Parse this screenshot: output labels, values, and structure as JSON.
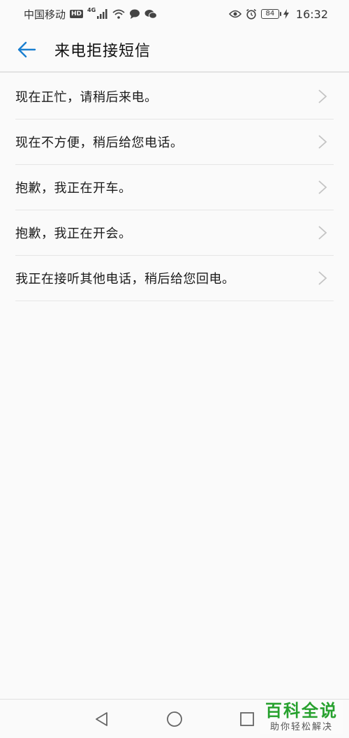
{
  "status_bar": {
    "carrier": "中国移动",
    "hd": "HD",
    "network": "4G",
    "battery": "84",
    "time": "16:32",
    "icons": [
      "hd-icon",
      "signal-icon",
      "wifi-icon",
      "message-icon",
      "wechat-icon",
      "eye-comfort-icon",
      "alarm-icon",
      "battery-icon",
      "charging-icon"
    ]
  },
  "header": {
    "title": "来电拒接短信",
    "back_icon": "back-arrow-icon"
  },
  "accent_color": "#1a7fd0",
  "replies": [
    {
      "label": "现在正忙，请稍后来电。"
    },
    {
      "label": "现在不方便，稍后给您电话。"
    },
    {
      "label": "抱歉，我正在开车。"
    },
    {
      "label": "抱歉，我正在开会。"
    },
    {
      "label": "我正在接听其他电话，稍后给您回电。"
    }
  ],
  "nav_bar": {
    "icons": [
      "back-triangle-icon",
      "home-circle-icon",
      "recents-square-icon"
    ]
  },
  "watermark": {
    "title": "百科全说",
    "subtitle": "助你轻松解决"
  }
}
